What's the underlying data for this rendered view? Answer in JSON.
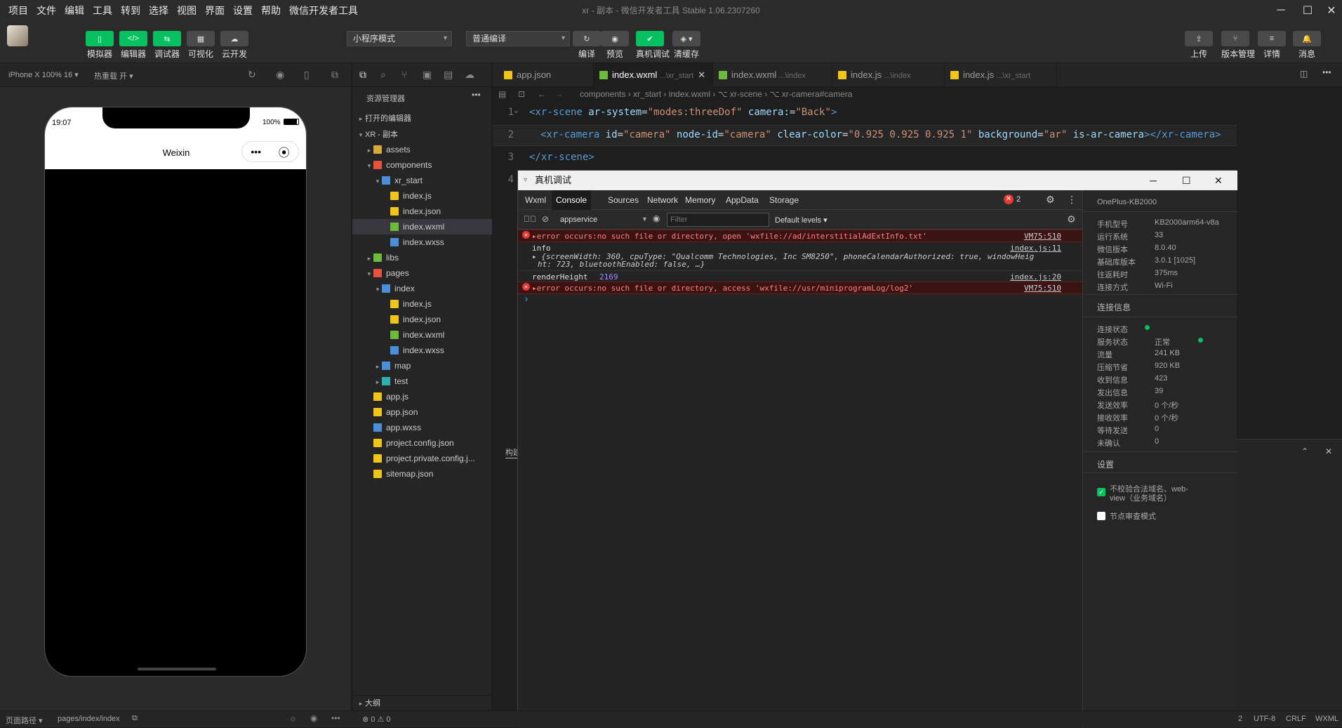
{
  "menu": [
    "项目",
    "文件",
    "编辑",
    "工具",
    "转到",
    "选择",
    "视图",
    "界面",
    "设置",
    "帮助",
    "微信开发者工具"
  ],
  "window_title": "xr - 副本 - 微信开发者工具 Stable 1.06.2307260",
  "toolbar": {
    "left_buttons": [
      {
        "label": "模拟器",
        "glyph": "▯"
      },
      {
        "label": "编辑器",
        "glyph": "</>"
      },
      {
        "label": "调试器",
        "glyph": "⇆"
      },
      {
        "label": "可视化",
        "glyph": "▦"
      },
      {
        "label": "云开发",
        "glyph": "☁"
      }
    ],
    "mode_select": "小程序模式",
    "compile_select": "普通编译",
    "center_buttons": [
      {
        "label": "编译",
        "glyph": "↻"
      },
      {
        "label": "预览",
        "glyph": "◉"
      },
      {
        "label": "真机调试",
        "glyph": "✔"
      },
      {
        "label": "清缓存",
        "glyph": "◈ ▾"
      }
    ],
    "right_buttons": [
      {
        "label": "上传",
        "glyph": "⇪"
      },
      {
        "label": "版本管理",
        "glyph": "⑂"
      },
      {
        "label": "详情",
        "glyph": "≡"
      },
      {
        "label": "消息",
        "glyph": "🔔"
      }
    ]
  },
  "simulator": {
    "device_select": "iPhone X 100% 16 ▾",
    "hotreload": "热重载 开 ▾",
    "time": "19:07",
    "battery": "100%",
    "nav_title": "Weixin",
    "capsule_dots": "•••",
    "capsule_circle": "⦿"
  },
  "explorer": {
    "title": "资源管理器",
    "open_editors": "打开的编辑器",
    "rows": [
      {
        "indent": 0,
        "arrow": "▾",
        "icon": "none",
        "label": "XR - 副本",
        "bold": true
      },
      {
        "indent": 1,
        "arrow": "▸",
        "icon": "folder",
        "label": "assets"
      },
      {
        "indent": 1,
        "arrow": "▾",
        "icon": "folder-red",
        "label": "components"
      },
      {
        "indent": 2,
        "arrow": "▾",
        "icon": "folder-blue",
        "label": "xr_start"
      },
      {
        "indent": 3,
        "arrow": "",
        "icon": "js",
        "label": "index.js"
      },
      {
        "indent": 3,
        "arrow": "",
        "icon": "json",
        "label": "index.json"
      },
      {
        "indent": 3,
        "arrow": "",
        "icon": "wxml",
        "label": "index.wxml",
        "selected": true
      },
      {
        "indent": 3,
        "arrow": "",
        "icon": "wxss",
        "label": "index.wxss"
      },
      {
        "indent": 1,
        "arrow": "▸",
        "icon": "folder-green",
        "label": "libs"
      },
      {
        "indent": 1,
        "arrow": "▾",
        "icon": "folder-red",
        "label": "pages"
      },
      {
        "indent": 2,
        "arrow": "▾",
        "icon": "folder-blue",
        "label": "index"
      },
      {
        "indent": 3,
        "arrow": "",
        "icon": "js",
        "label": "index.js"
      },
      {
        "indent": 3,
        "arrow": "",
        "icon": "json",
        "label": "index.json"
      },
      {
        "indent": 3,
        "arrow": "",
        "icon": "wxml",
        "label": "index.wxml"
      },
      {
        "indent": 3,
        "arrow": "",
        "icon": "wxss",
        "label": "index.wxss"
      },
      {
        "indent": 2,
        "arrow": "▸",
        "icon": "folder-blue",
        "label": "map"
      },
      {
        "indent": 2,
        "arrow": "▸",
        "icon": "folder-teal",
        "label": "test"
      },
      {
        "indent": 1,
        "arrow": "",
        "icon": "js",
        "label": "app.js"
      },
      {
        "indent": 1,
        "arrow": "",
        "icon": "json",
        "label": "app.json"
      },
      {
        "indent": 1,
        "arrow": "",
        "icon": "wxss",
        "label": "app.wxss"
      },
      {
        "indent": 1,
        "arrow": "",
        "icon": "json",
        "label": "project.config.json"
      },
      {
        "indent": 1,
        "arrow": "",
        "icon": "json",
        "label": "project.private.config.j..."
      },
      {
        "indent": 1,
        "arrow": "",
        "icon": "json",
        "label": "sitemap.json"
      }
    ],
    "outline": "大纲"
  },
  "editor": {
    "tabs": [
      {
        "icon": "json",
        "label": "app.json",
        "sub": ""
      },
      {
        "icon": "wxml",
        "label": "index.wxml",
        "sub": " ...\\xr_start",
        "active": true,
        "close": "✕"
      },
      {
        "icon": "wxml",
        "label": "index.wxml",
        "sub": " ...\\index"
      },
      {
        "icon": "js",
        "label": "index.js",
        "sub": " ...\\index"
      },
      {
        "icon": "js",
        "label": "index.js",
        "sub": " ...\\xr_start"
      }
    ],
    "breadcrumb": "components › xr_start › index.wxml › ⌥ xr-scene › ⌥ xr-camera#camera",
    "line_numbers": [
      "1",
      "2",
      "3",
      "4"
    ]
  },
  "devtools": {
    "title": "真机调试",
    "tabs": [
      "Wxml",
      "Console",
      "Sources",
      "Network",
      "Memory",
      "AppData",
      "Storage"
    ],
    "active_tab": "Console",
    "error_count": "2",
    "context": "appservice",
    "filter_placeholder": "Filter",
    "levels": "Default levels ▾",
    "logs": {
      "err1_text": "▸error occurs:no such file or directory, open 'wxfile://ad/interstitialAdExtInfo.txt'",
      "err1_src": "VM75:510",
      "info_label": "info",
      "info_src": "index.js:11",
      "info_obj1": "▸ {screenWidth: 360, cpuType: \"Qualcomm Technologies, Inc SM8250\", phoneCalendarAuthorized: true, windowHeig",
      "info_obj2": "ht: 723, bluetoothEnabled: false, …}",
      "render_label": "renderHeight",
      "render_value": "2169",
      "render_src": "index.js:20",
      "err2_text": "▸error occurs:no such file or directory, access 'wxfile://usr/miniprogramLog/log2'",
      "err2_src": "VM75:510",
      "prompt": "›"
    },
    "device": {
      "name": "OnePlus-KB2000",
      "info": [
        {
          "k": "手机型号",
          "v": "KB2000arm64-v8a"
        },
        {
          "k": "运行系统",
          "v": "33"
        },
        {
          "k": "微信版本",
          "v": "8.0.40"
        },
        {
          "k": "基础库版本",
          "v": "3.0.1 [1025]"
        },
        {
          "k": "往返耗时",
          "v": "375ms"
        },
        {
          "k": "连接方式",
          "v": "Wi-Fi"
        }
      ],
      "conn_title": "连接信息",
      "conn": [
        {
          "k": "连接状态",
          "v": ""
        },
        {
          "k": "服务状态",
          "v": "正常"
        },
        {
          "k": "流量",
          "v": "241 KB"
        },
        {
          "k": "压缩节省",
          "v": "920 KB"
        },
        {
          "k": "收到信息",
          "v": "423"
        },
        {
          "k": "发出信息",
          "v": "39"
        },
        {
          "k": "发送效率",
          "v": "0 个/秒"
        },
        {
          "k": "接收效率",
          "v": "0 个/秒"
        },
        {
          "k": "等待发送",
          "v": "0"
        },
        {
          "k": "未确认",
          "v": "0"
        }
      ],
      "settings_title": "设置",
      "opt1": "不校验合法域名、web-view（业务域名）",
      "opt2": "节点审查模式"
    }
  },
  "statusbar": {
    "left1": "页面路径 ▾",
    "path": "pages/index/index",
    "problems": "⊗ 0 ⚠ 0",
    "right": [
      "2",
      "UTF-8",
      "CRLF",
      "WXML"
    ]
  },
  "side_panel_label": "构建"
}
